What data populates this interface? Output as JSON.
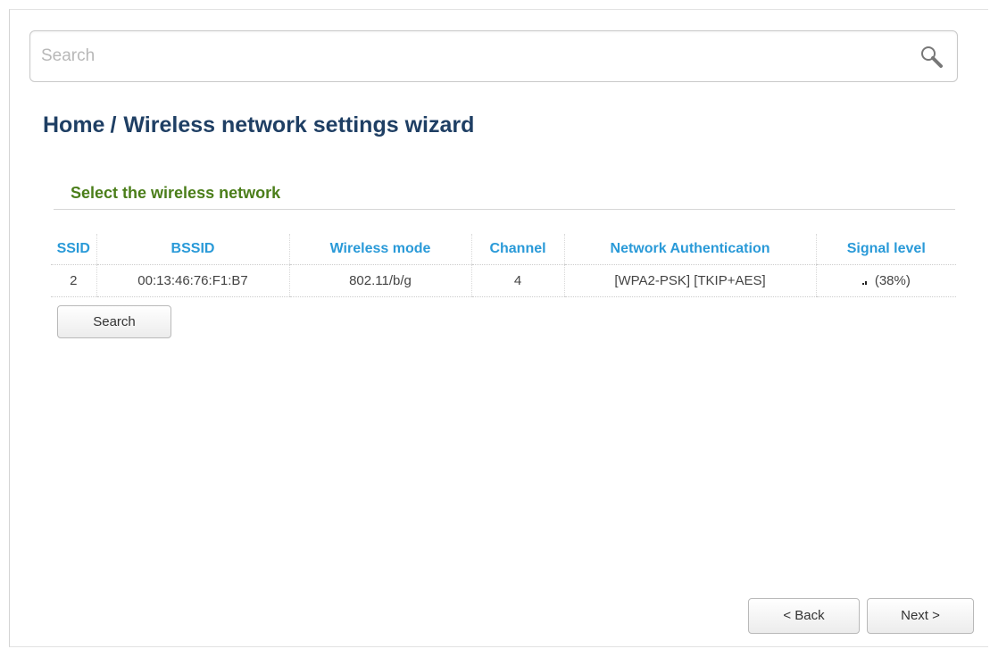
{
  "search": {
    "placeholder": "Search"
  },
  "breadcrumb": {
    "home": "Home",
    "separator": "/",
    "current": "Wireless network settings wizard"
  },
  "section": {
    "title": "Select the wireless network"
  },
  "table": {
    "headers": [
      "SSID",
      "BSSID",
      "Wireless mode",
      "Channel",
      "Network Authentication",
      "Signal level"
    ],
    "rows": [
      {
        "ssid": "2",
        "bssid": "00:13:46:76:F1:B7",
        "mode": "802.11/b/g",
        "channel": "4",
        "auth": "[WPA2-PSK] [TKIP+AES]",
        "signal": "(38%)",
        "signal_fraction": 0.38
      }
    ]
  },
  "buttons": {
    "search": "Search",
    "back": "< Back",
    "next": "Next >"
  },
  "colors": {
    "title": "#1f3f64",
    "section": "#4b7e1a",
    "header": "#2a9ad8"
  },
  "icons": {
    "search": "search-icon",
    "signal": "signal-bars-icon"
  }
}
